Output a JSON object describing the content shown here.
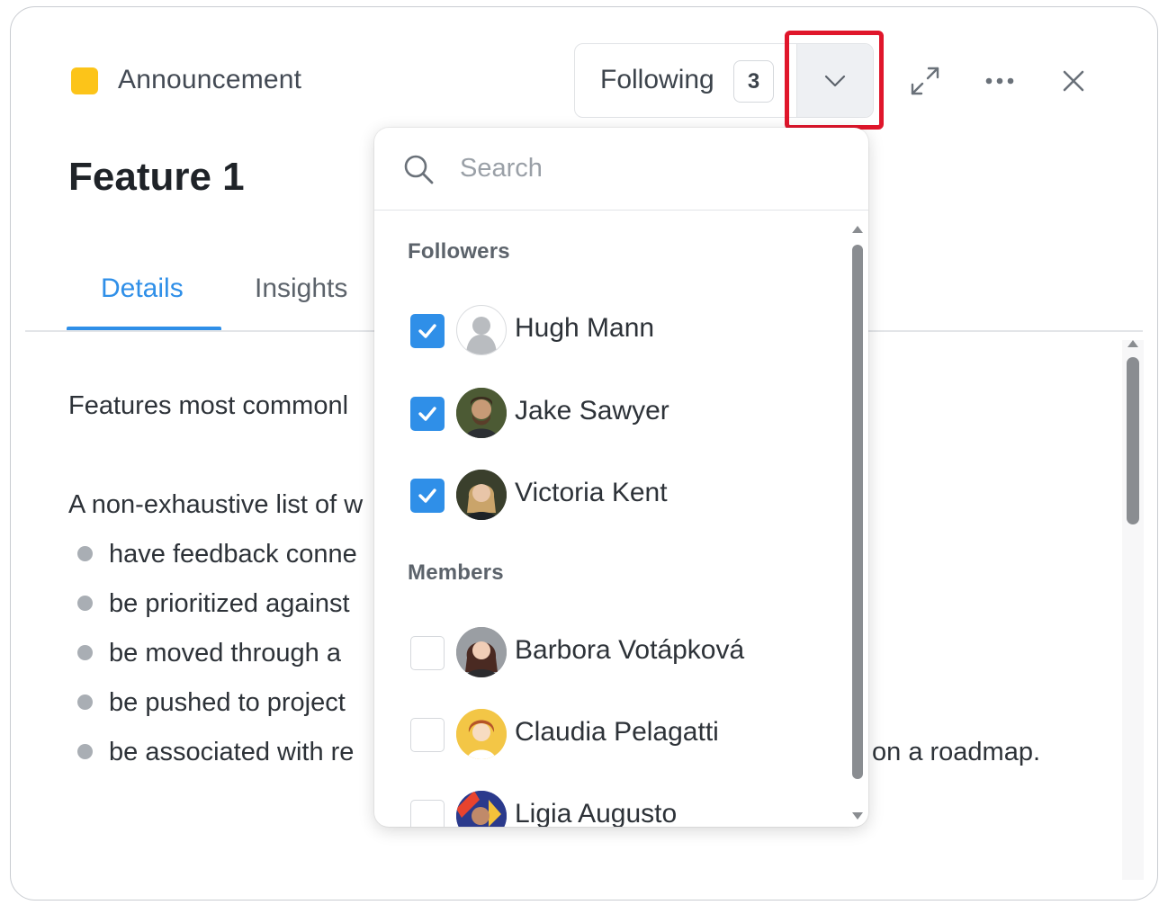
{
  "header": {
    "type_label": "Announcement",
    "type_color": "#fcc419",
    "following_label": "Following",
    "following_count": "3",
    "dropdown_toggle_icon": "chevron-down-icon",
    "expand_icon": "expand-icon",
    "more_icon": "more-horizontal-icon",
    "close_icon": "close-icon"
  },
  "title": "Feature 1",
  "tabs": [
    {
      "label": "Details",
      "active": true
    },
    {
      "label": "Insights",
      "active": false
    }
  ],
  "content": {
    "paragraph1": "Features most commonl",
    "paragraph2": "A non-exhaustive list of w",
    "bullets": [
      "have feedback conne",
      "be prioritized against",
      "be moved through a",
      "be pushed to project",
      "be associated with re"
    ],
    "bullet5_tail": "on a roadmap."
  },
  "followers_dropdown": {
    "search_placeholder": "Search",
    "followers_label": "Followers",
    "followers": [
      {
        "name": "Hugh Mann",
        "checked": true
      },
      {
        "name": "Jake Sawyer",
        "checked": true
      },
      {
        "name": "Victoria Kent",
        "checked": true
      }
    ],
    "members_label": "Members",
    "members": [
      {
        "name": "Barbora Votápková",
        "checked": false
      },
      {
        "name": "Claudia Pelagatti",
        "checked": false
      },
      {
        "name": "Ligia Augusto",
        "checked": false
      }
    ]
  },
  "colors": {
    "accent": "#2f8fe8",
    "highlight": "#e0162b"
  }
}
